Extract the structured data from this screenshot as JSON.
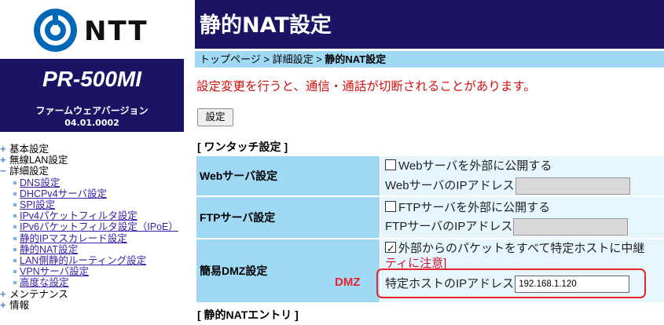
{
  "sidebar": {
    "logo_text": "NTT",
    "model": "PR-500MI",
    "firmware_label": "ファームウェアバージョン",
    "firmware_version": "04.01.0002",
    "menu": [
      {
        "type": "top",
        "sign": "+",
        "label": "基本設定"
      },
      {
        "type": "top",
        "sign": "+",
        "label": "無線LAN設定"
      },
      {
        "type": "top",
        "sign": "−",
        "label": "詳細設定"
      },
      {
        "type": "sub",
        "label": "DNS設定"
      },
      {
        "type": "sub",
        "label": "DHCPv4サーバ設定"
      },
      {
        "type": "sub",
        "label": "SPI設定"
      },
      {
        "type": "sub",
        "label": "IPv4パケットフィルタ設定"
      },
      {
        "type": "sub",
        "label": "IPv6パケットフィルタ設定（IPoE）"
      },
      {
        "type": "sub",
        "label": "静的IPマスカレード設定"
      },
      {
        "type": "sub",
        "label": "静的NAT設定"
      },
      {
        "type": "sub",
        "label": "LAN側静的ルーティング設定"
      },
      {
        "type": "sub",
        "label": "VPNサーバ設定"
      },
      {
        "type": "sub",
        "label": "高度な設定"
      },
      {
        "type": "top",
        "sign": "+",
        "label": "メンテナンス"
      },
      {
        "type": "top",
        "sign": "+",
        "label": "情報"
      }
    ]
  },
  "header": {
    "title": "静的NAT設定"
  },
  "breadcrumb": {
    "top": "トップページ",
    "sep": " > ",
    "middle": "詳細設定",
    "current": "静的NAT設定"
  },
  "warning": "設定変更を行うと、通信・通話が切断されることがあります。",
  "settings_button": "設定",
  "sections": {
    "onetouch": "[ ワンタッチ設定 ]",
    "static_nat_entry": "[ 静的NATエントリ ]"
  },
  "onetouch": {
    "web": {
      "label": "Webサーバ設定",
      "checkbox_label": "Webサーバを外部に公開する",
      "checked": false,
      "ip_label": "WebサーバのIPアドレス",
      "ip_value": ""
    },
    "ftp": {
      "label": "FTPサーバ設定",
      "checkbox_label": "FTPサーバを外部に公開する",
      "checked": false,
      "ip_label": "FTPサーバのIPアドレス",
      "ip_value": ""
    },
    "dmz": {
      "label": "簡易DMZ設定",
      "checkbox_label": "外部からのパケットをすべて特定ホストに中継",
      "checked": true,
      "note": "ティに注意]",
      "ip_label": "特定ホストのIPアドレス",
      "ip_value": "192.168.1.120"
    }
  },
  "annotation": {
    "label": "DMZ",
    "color": "#e8242c"
  },
  "colors": {
    "header_bg": "#1b1464",
    "label_bg": "#9fd9f3",
    "cell_bg": "#e6f6fc",
    "warning": "#d20f0f",
    "link": "#3b1ea8",
    "logo_blue": "#0068b7"
  }
}
